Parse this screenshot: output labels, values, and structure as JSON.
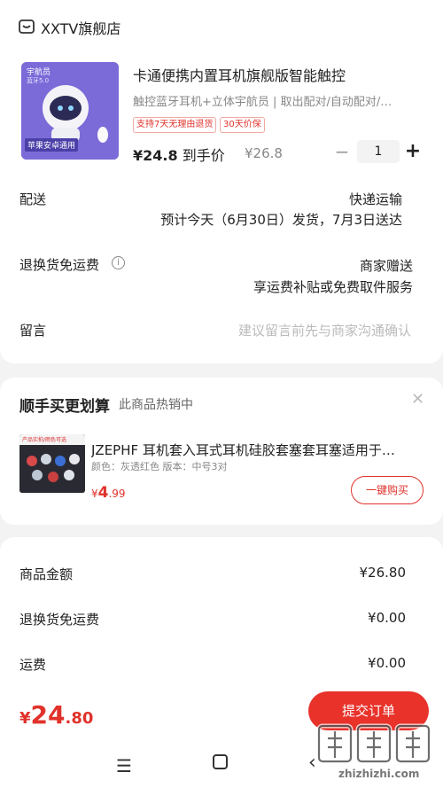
{
  "shop": {
    "name": "XXTV旗舰店"
  },
  "product": {
    "title": "卡通便携内置耳机旗舰版智能触控",
    "subtitle": "触控蓝牙耳机+立体宇航员 | 取出配对/自动配对/…",
    "tags": [
      "支持7天无理由退货",
      "30天价保"
    ],
    "price_label": "¥24.8 到手价",
    "price_value": "¥24.8",
    "price_suffix": "到手价",
    "original_price": "¥26.8",
    "quantity": "1",
    "image_text": {
      "brand": "宇航员",
      "brand_sub": "蓝牙5.0",
      "caption": "苹果安卓通用"
    }
  },
  "delivery": {
    "label": "配送",
    "method": "快递运输",
    "estimate": "预计今天（6月30日）发货，7月3日送达"
  },
  "return_shipping": {
    "label": "退换货免运费",
    "value": "商家赠送",
    "desc": "享运费补贴或免费取件服务"
  },
  "message": {
    "label": "留言",
    "placeholder": "建议留言前先与商家沟通确认"
  },
  "upsell": {
    "title": "顺手买更划算",
    "subtitle": "此商品热销中",
    "item": {
      "name": "JZEPHF 耳机套入耳式耳机硅胶套塞套耳塞适用于…",
      "spec": "颜色：灰透红色   版本：中号3对",
      "price_symbol": "¥",
      "price_int": "4",
      "price_dec": ".99",
      "buy_label": "一键购买",
      "image_text": "产品实拍/雨色可选"
    }
  },
  "summary": {
    "rows": [
      {
        "label": "商品金额",
        "value": "¥26.80"
      },
      {
        "label": "退换货免运费",
        "value": "¥0.00"
      },
      {
        "label": "运费",
        "value": "¥0.00"
      }
    ]
  },
  "footer": {
    "total_symbol": "¥",
    "total_int": "24",
    "total_dec": ".80",
    "submit_label": "提交订单"
  },
  "watermark": {
    "text": "zhizhizhi.com"
  },
  "colors": {
    "accent": "#e8322a",
    "background": "#f3f3f3"
  },
  "icons": [
    "shop-icon",
    "info-icon",
    "close-icon",
    "menu-icon",
    "home-icon",
    "back-icon"
  ]
}
